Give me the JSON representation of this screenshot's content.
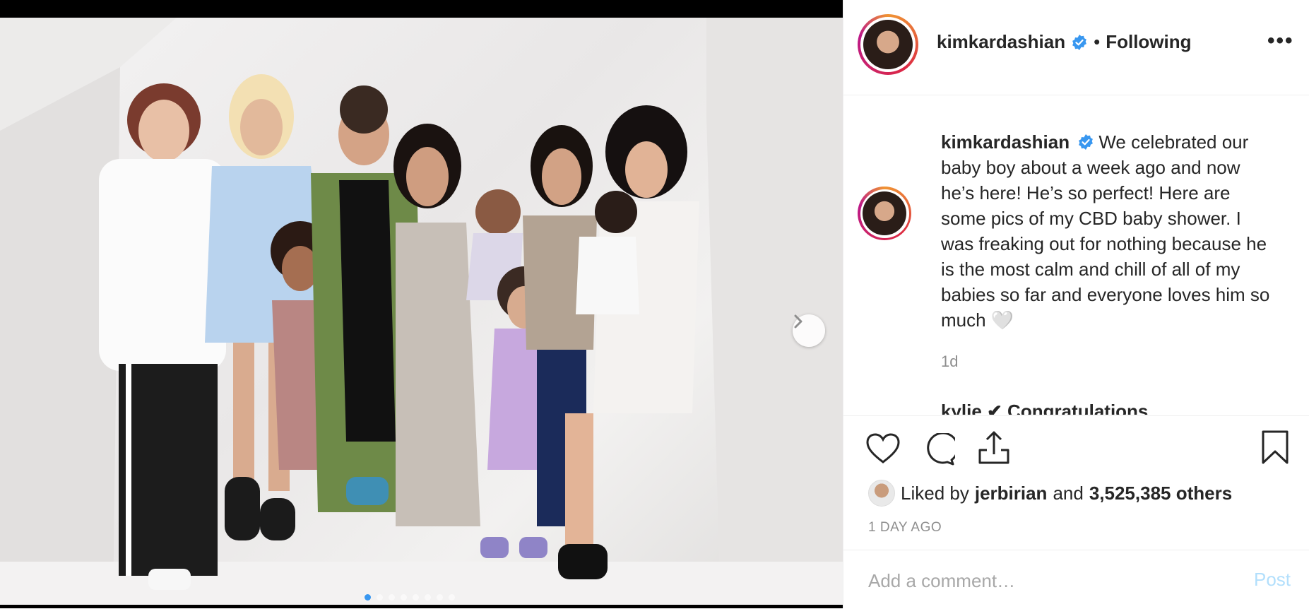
{
  "post": {
    "username": "kimkardashian",
    "following_label": "Following",
    "separator": "•",
    "more_label": "•••"
  },
  "caption": {
    "username": "kimkardashian",
    "text": "We celebrated our baby boy about a week ago and now he’s here! He’s so perfect! Here are some pics of my CBD baby shower. I was freaking out for nothing because he is the most calm and chill of all of my babies so far and everyone loves him so much 🤍",
    "time": "1d"
  },
  "clipped_comment": "kylie ✔ Congratulations",
  "likes": {
    "prefix": "Liked by",
    "user": "jerbirian",
    "middle": "and",
    "count": "3,525,385 others"
  },
  "date": "1 DAY AGO",
  "comment_box": {
    "placeholder": "Add a comment…",
    "post_label": "Post"
  },
  "carousel": {
    "count": 8,
    "active": 0
  },
  "colors": {
    "verified": "#3897f0",
    "post_disabled": "#b2dffc",
    "muted": "#8e8e8e"
  }
}
